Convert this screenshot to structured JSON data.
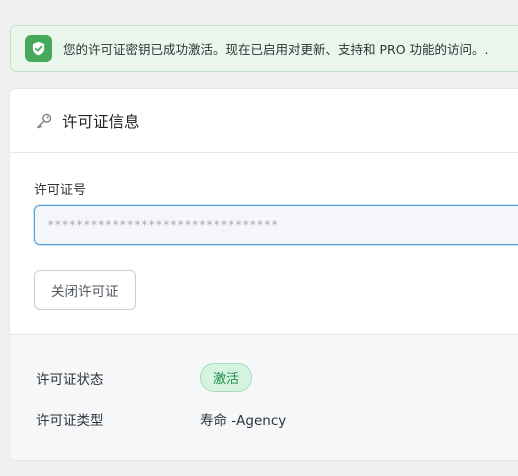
{
  "notice": {
    "icon": "check-shield-icon",
    "text": "您的许可证密钥已成功激活。现在已启用对更新、支持和 PRO 功能的访问。."
  },
  "card": {
    "icon": "key-icon",
    "title": "许可证信息",
    "license_field": {
      "label": "许可证号",
      "value": "********************************"
    },
    "deactivate_label": "关闭许可证",
    "status": {
      "label": "许可证状态",
      "value": "激活"
    },
    "type": {
      "label": "许可证类型",
      "value": "寿命 -Agency"
    }
  },
  "colors": {
    "success": "#46a85b",
    "notice_bg": "#eaf6ec",
    "focus_border": "#4f9fd8",
    "badge_bg": "#d6f3e0",
    "badge_text": "#1f8a4c"
  }
}
